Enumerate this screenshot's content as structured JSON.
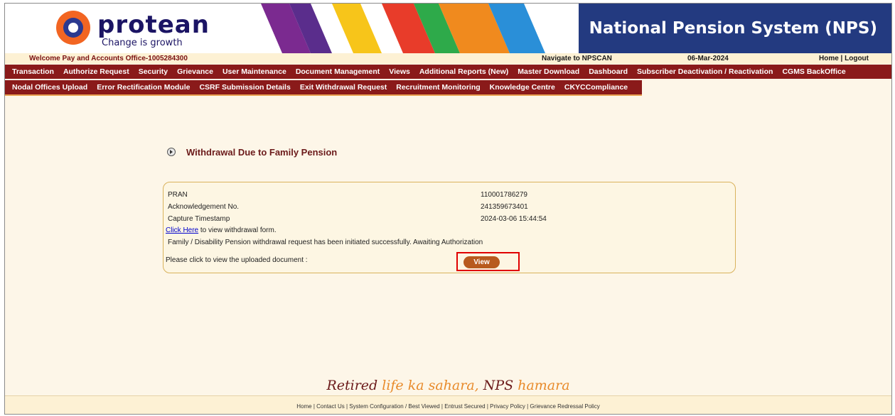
{
  "header": {
    "logo_name": "protean",
    "logo_tagline": "Change is growth",
    "title": "National Pension System (NPS)"
  },
  "infobar": {
    "welcome": "Welcome Pay and Accounts Office-1005284300",
    "navigate": "Navigate to NPSCAN",
    "date": "06-Mar-2024",
    "home_logout": "Home | Logout"
  },
  "menu_row1": [
    "Transaction",
    "Authorize Request",
    "Security",
    "Grievance",
    "User Maintenance",
    "Document Management",
    "Views",
    "Additional Reports (New)",
    "Master Download",
    "Dashboard",
    "Subscriber Deactivation / Reactivation",
    "CGMS BackOffice"
  ],
  "menu_row2": [
    "Nodal Offices Upload",
    "Error Rectification Module",
    "CSRF Submission Details",
    "Exit Withdrawal Request",
    "Recruitment Monitoring",
    "Knowledge Centre",
    "CKYCCompliance"
  ],
  "page": {
    "section_title": "Withdrawal Due to Family Pension"
  },
  "details": {
    "pran_label": "PRAN",
    "pran_value": "110001786279",
    "ack_label": "Acknowledgement No.",
    "ack_value": "241359673401",
    "ts_label": "Capture Timestamp",
    "ts_value": "2024-03-06 15:44:54",
    "click_here": "Click Here",
    "click_suffix": " to view withdrawal form.",
    "status_msg": "Family / Disability Pension withdrawal request has been initiated successfully. Awaiting Authorization",
    "upload_prompt": "Please click to view the uploaded document :",
    "view_label": "View"
  },
  "slogan": {
    "part1": "Retired ",
    "part2": "life ka sahara, ",
    "part3": "NPS ",
    "part4": "hamara"
  },
  "footer": {
    "links": "Home | Contact Us | System Configuration / Best Viewed | Entrust Secured | Privacy Policy | Grievance Redressal Policy"
  },
  "colors": {
    "menu_bg": "#8a1a1a",
    "banner_bg": "#233a80",
    "page_bg": "#fdf6e8",
    "highlight": "#e00000",
    "button": "#b85a1e"
  }
}
